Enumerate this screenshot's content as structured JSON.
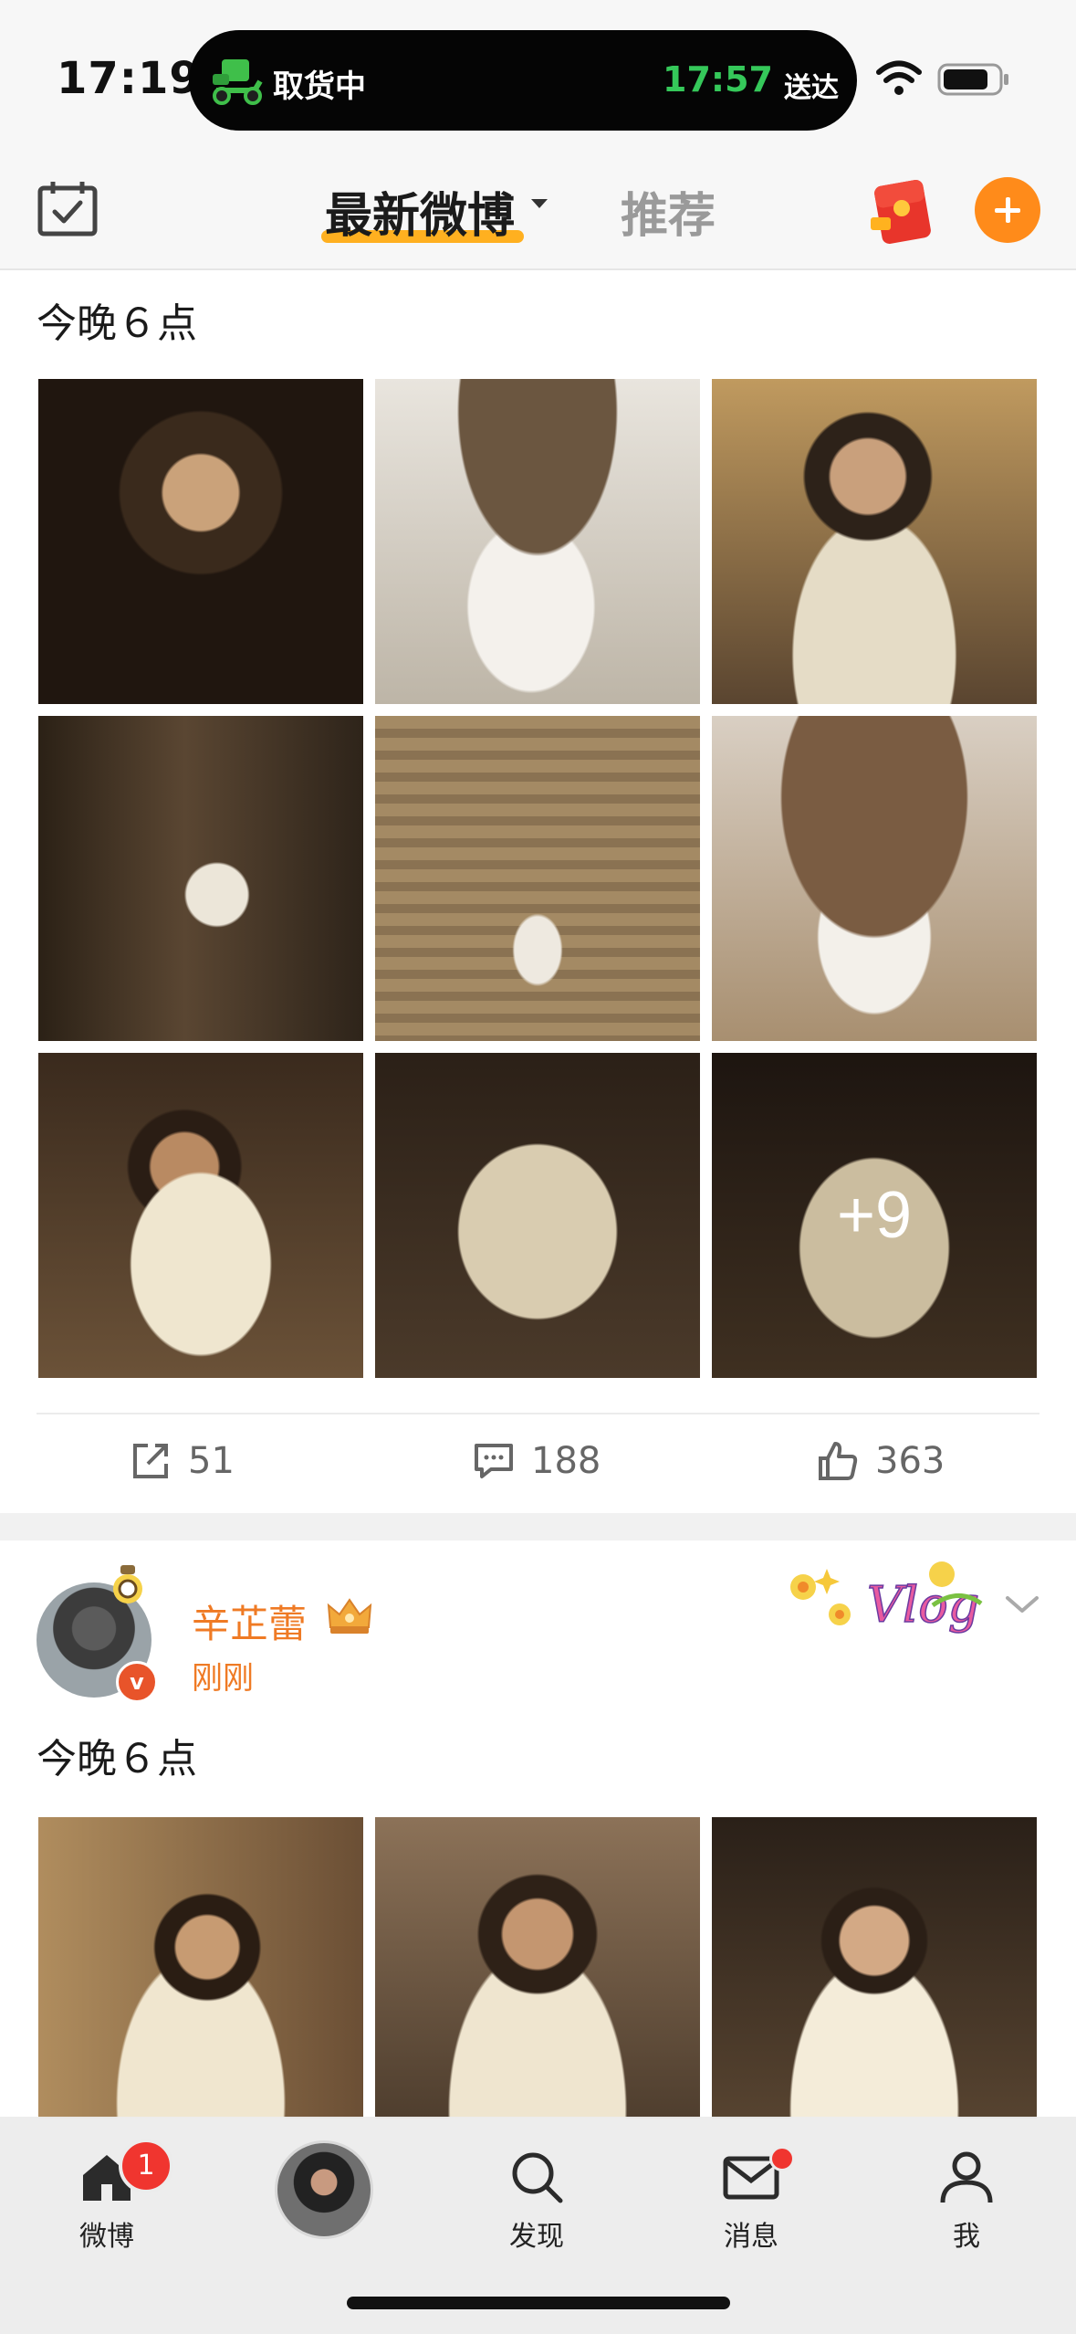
{
  "status_bar": {
    "time": "17:19",
    "island_label": "取货中",
    "island_eta": "17:57",
    "island_eta_suffix": "送达"
  },
  "nav": {
    "tab_latest": "最新微博",
    "tab_recommend": "推荐"
  },
  "post1": {
    "text": "今晚６点",
    "more_images": "+9",
    "repost_count": "51",
    "comment_count": "188",
    "like_count": "363"
  },
  "post2": {
    "author": "辛芷蕾",
    "time": "刚刚",
    "text": "今晚６点",
    "avatar_badge": "v"
  },
  "tab_bar": {
    "home_label": "微博",
    "home_badge": "1",
    "discover_label": "发现",
    "messages_label": "消息",
    "me_label": "我"
  },
  "colors": {
    "accent": "#ff8b1a",
    "underline": "#ffb020",
    "name": "#ef7a24",
    "badge": "#f0352f",
    "eta": "#35c85a"
  }
}
